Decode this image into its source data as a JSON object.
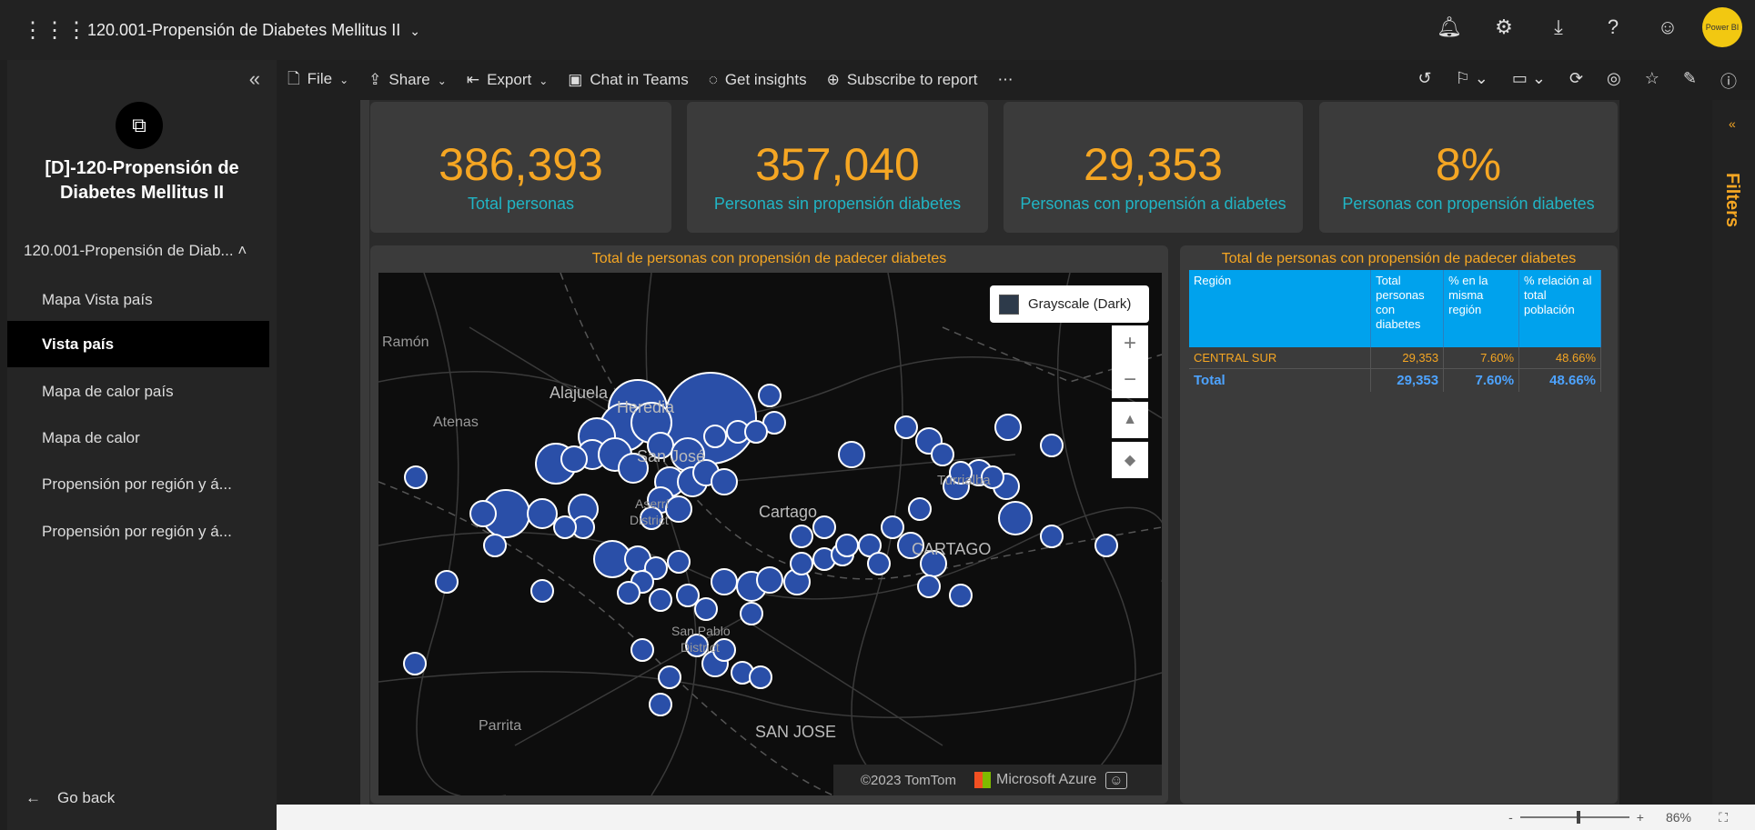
{
  "app": {
    "report_title": "120.001-Propensión de Diabetes Mellitus II",
    "avatar_label": "Power BI"
  },
  "sidebar": {
    "workspace_name": "[D]-120-Propensión de Diabetes Mellitus II",
    "group_label": "120.001-Propensión de Diab...",
    "items": [
      {
        "label": "Mapa Vista país",
        "active": false
      },
      {
        "label": "Vista país",
        "active": true
      },
      {
        "label": "Mapa de calor país",
        "active": false
      },
      {
        "label": "Mapa de calor",
        "active": false
      },
      {
        "label": "Propensión por región y á...",
        "active": false
      },
      {
        "label": "Propensión por región y á...",
        "active": false
      }
    ],
    "go_back": "Go back"
  },
  "toolbar": {
    "file": "File",
    "share": "Share",
    "export": "Export",
    "chat": "Chat in Teams",
    "insights": "Get insights",
    "subscribe": "Subscribe to report",
    "more": "⋯"
  },
  "kpis": [
    {
      "value": "386,393",
      "label": "Total personas"
    },
    {
      "value": "357,040",
      "label": "Personas sin propensión diabetes"
    },
    {
      "value": "29,353",
      "label": "Personas con propensión a diabetes"
    },
    {
      "value": "8%",
      "label": "Personas con propensión diabetes"
    }
  ],
  "map_visual": {
    "title": "Total de personas con propensión de padecer diabetes",
    "basemap": "Grayscale (Dark)",
    "labels": {
      "ramon": "Ramón",
      "alajuela": "Alajuela",
      "heredia": "Heredia",
      "atenas": "Atenas",
      "sanjose": "San José",
      "aserri": "Aserrí",
      "district": "District",
      "cartago": "Cartago",
      "turrialba": "Turrialba",
      "cartago_prov": "CARTAGO",
      "sanpablo": "San Pablo",
      "district2": "District",
      "parrita": "Parrita",
      "sanjose_prov": "SAN JOSE"
    },
    "attribution": "©2023 TomTom",
    "azure": "Microsoft Azure"
  },
  "table_visual": {
    "title": "Total de personas con propensión de padecer diabetes",
    "headers": [
      "Región",
      "Total personas con diabetes",
      "% en la misma región",
      "% relación al total población"
    ],
    "rows": [
      [
        "CENTRAL SUR",
        "29,353",
        "7.60%",
        "48.66%"
      ]
    ],
    "total": [
      "Total",
      "29,353",
      "7.60%",
      "48.66%"
    ]
  },
  "filters": {
    "label": "Filters"
  },
  "status": {
    "zoom": "86%"
  },
  "colors": {
    "accent": "#f5a623",
    "kpi_label": "#21b5c5",
    "bubble": "#2a4fa8",
    "table_header": "#00a2ed"
  }
}
